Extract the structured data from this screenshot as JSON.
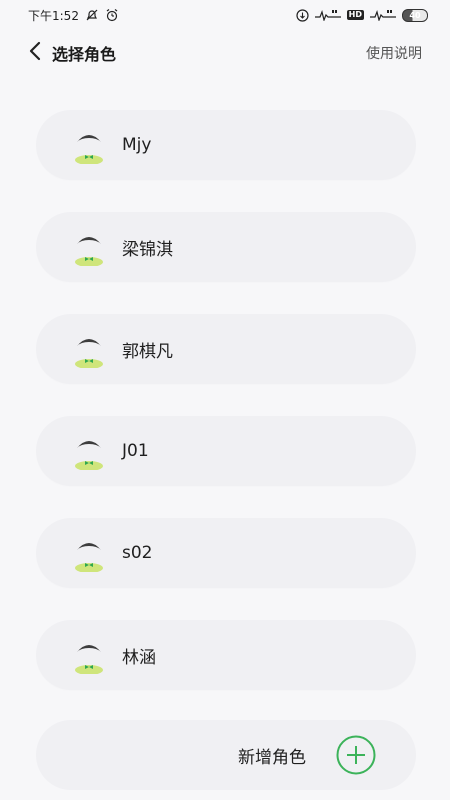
{
  "status_bar": {
    "time": "下午1:52",
    "network_badge": "HD",
    "battery_percent": "40"
  },
  "header": {
    "title": "选择角色",
    "help_label": "使用说明"
  },
  "roles": [
    {
      "name": "Mjy"
    },
    {
      "name": "梁锦淇"
    },
    {
      "name": "郭棋凡"
    },
    {
      "name": "J01"
    },
    {
      "name": "s02"
    },
    {
      "name": "林涵"
    }
  ],
  "add_role": {
    "label": "新增角色"
  },
  "colors": {
    "accent_green": "#3cb35a",
    "avatar_hair": "#3d3d3d",
    "avatar_body": "#cfe57b",
    "bow_tie": "#2fa84f"
  }
}
